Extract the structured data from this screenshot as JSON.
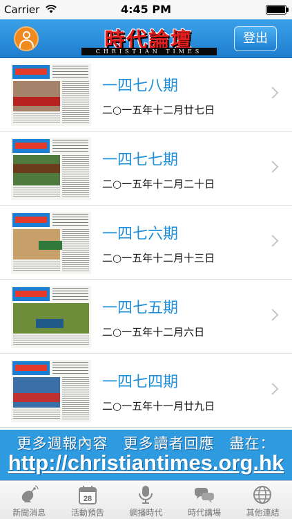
{
  "status_bar": {
    "carrier": "Carrier",
    "time": "4:45 PM"
  },
  "header": {
    "logo_cn": "時代論壇",
    "logo_en": "CHRISTIAN TIMES",
    "logout_label": "登出"
  },
  "issues": [
    {
      "title": "一四七八期",
      "date": "二○一五年十二月廿七日",
      "thumb_color": "#a5826a",
      "banner": "#b92121"
    },
    {
      "title": "一四七七期",
      "date": "二○一五年十二月二十日",
      "thumb_color": "#4e7a3f",
      "banner": "#6b3b1c"
    },
    {
      "title": "一四七六期",
      "date": "二○一五年十二月十三日",
      "thumb_color": "#c7a06a",
      "banner": "#2f7a3a"
    },
    {
      "title": "一四七五期",
      "date": "二○一五年十二月六日",
      "thumb_color": "#6d8d3a",
      "banner": "#1f5a8a"
    },
    {
      "title": "一四七四期",
      "date": "二○一五年十一月廿九日",
      "thumb_color": "#3b6fa8",
      "banner": "#c03030"
    }
  ],
  "banner": {
    "line1": "更多週報內容　更多讀者回應　盡在：",
    "line2": "http://christiantimes.org.hk"
  },
  "tabs": [
    {
      "label": "新聞消息",
      "icon": "satellite-dish-icon"
    },
    {
      "label": "活動預告",
      "icon": "calendar-icon"
    },
    {
      "label": "網播時代",
      "icon": "microphone-icon"
    },
    {
      "label": "時代講場",
      "icon": "chat-bubbles-icon"
    },
    {
      "label": "其他連結",
      "icon": "globe-icon"
    }
  ],
  "calendar_day": "28"
}
